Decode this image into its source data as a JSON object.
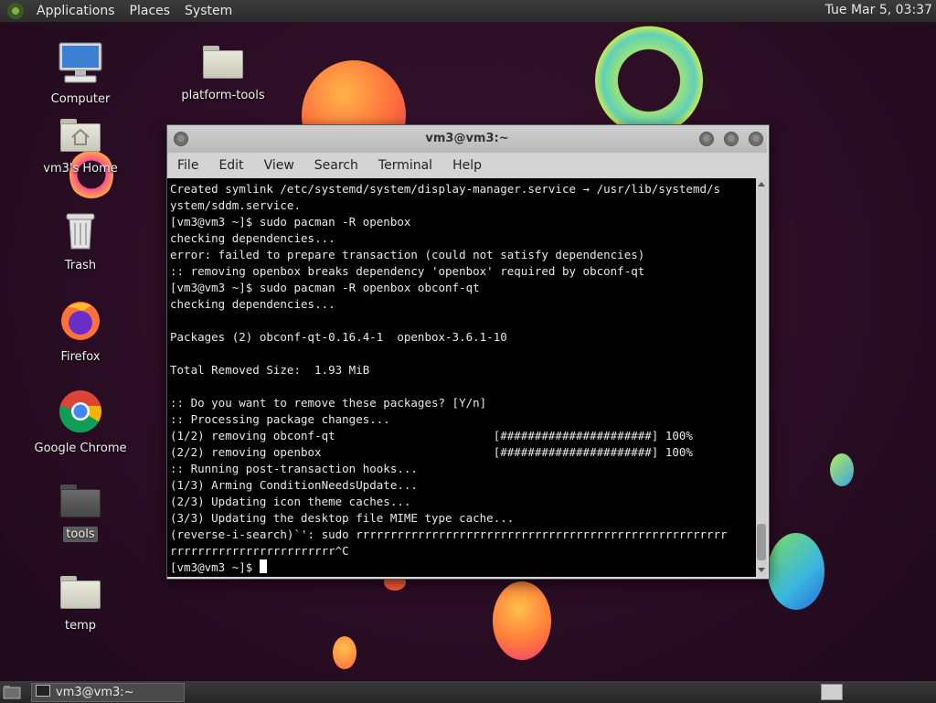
{
  "top_panel": {
    "menus": [
      "Applications",
      "Places",
      "System"
    ],
    "clock": "Tue Mar  5, 03:37"
  },
  "desktop_icons": {
    "computer": "Computer",
    "platform_tools": "platform-tools",
    "home": "vm3's Home",
    "trash": "Trash",
    "firefox": "Firefox",
    "chrome": "Google Chrome",
    "tools": "tools",
    "temp": "temp"
  },
  "terminal": {
    "title": "vm3@vm3:~",
    "menu": [
      "File",
      "Edit",
      "View",
      "Search",
      "Terminal",
      "Help"
    ],
    "lines": [
      "Created symlink /etc/systemd/system/display-manager.service → /usr/lib/systemd/s",
      "ystem/sddm.service.",
      "[vm3@vm3 ~]$ sudo pacman -R openbox",
      "checking dependencies...",
      "error: failed to prepare transaction (could not satisfy dependencies)",
      ":: removing openbox breaks dependency 'openbox' required by obconf-qt",
      "[vm3@vm3 ~]$ sudo pacman -R openbox obconf-qt",
      "checking dependencies...",
      "",
      "Packages (2) obconf-qt-0.16.4-1  openbox-3.6.1-10",
      "",
      "Total Removed Size:  1.93 MiB",
      "",
      ":: Do you want to remove these packages? [Y/n]",
      ":: Processing package changes...",
      "(1/2) removing obconf-qt                       [######################] 100%",
      "(2/2) removing openbox                         [######################] 100%",
      ":: Running post-transaction hooks...",
      "(1/3) Arming ConditionNeedsUpdate...",
      "(2/3) Updating icon theme caches...",
      "(3/3) Updating the desktop file MIME type cache...",
      "(reverse-i-search)`': sudo rrrrrrrrrrrrrrrrrrrrrrrrrrrrrrrrrrrrrrrrrrrrrrrrrrrrrr",
      "rrrrrrrrrrrrrrrrrrrrrrrr^C"
    ],
    "prompt": "[vm3@vm3 ~]$ "
  },
  "taskbar": {
    "window_button": "vm3@vm3:~"
  }
}
